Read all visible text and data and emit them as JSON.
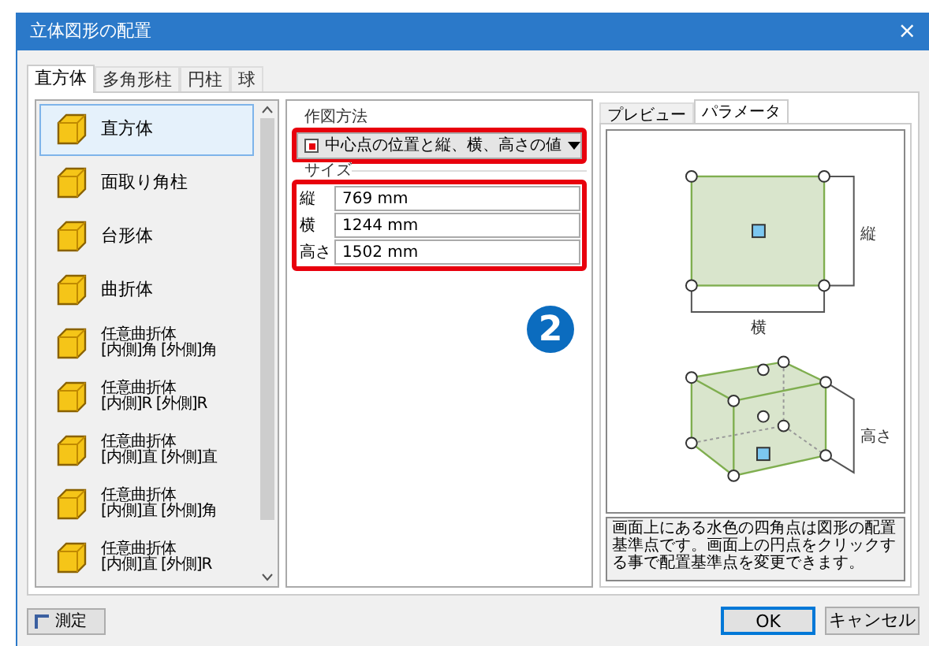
{
  "window": {
    "title": "立体図形の配置",
    "close": "×"
  },
  "shape_tabs": [
    {
      "label": "直方体",
      "selected": true
    },
    {
      "label": "多角形柱",
      "selected": false
    },
    {
      "label": "円柱",
      "selected": false
    },
    {
      "label": "球",
      "selected": false
    }
  ],
  "shape_list": [
    {
      "lines": [
        "直方体"
      ],
      "selected": true
    },
    {
      "lines": [
        "面取り角柱"
      ],
      "selected": false
    },
    {
      "lines": [
        "台形体"
      ],
      "selected": false
    },
    {
      "lines": [
        "曲折体"
      ],
      "selected": false
    },
    {
      "lines": [
        "任意曲折体",
        "[内側]角 [外側]角"
      ],
      "selected": false
    },
    {
      "lines": [
        "任意曲折体",
        "[内側]R [外側]R"
      ],
      "selected": false
    },
    {
      "lines": [
        "任意曲折体",
        "[内側]直 [外側]直"
      ],
      "selected": false
    },
    {
      "lines": [
        "任意曲折体",
        "[内側]直 [外側]角"
      ],
      "selected": false
    },
    {
      "lines": [
        "任意曲折体",
        "[内側]直 [外側]R"
      ],
      "selected": false
    }
  ],
  "method": {
    "label": "作図方法",
    "value": "中心点の位置と縦、横、高さの値"
  },
  "size": {
    "label": "サイズ",
    "fields": [
      {
        "label": "縦",
        "value": "769 mm"
      },
      {
        "label": "横",
        "value": "1244 mm"
      },
      {
        "label": "高さ",
        "value": "1502 mm"
      }
    ]
  },
  "callout": "2",
  "preview_tabs": [
    {
      "label": "プレビュー",
      "selected": false
    },
    {
      "label": "パラメータ",
      "selected": true
    }
  ],
  "diagram_labels": {
    "height": "縦",
    "width": "横",
    "depth": "高さ"
  },
  "description": "画面上にある水色の四角点は図形の配置基準点です。画面上の円点をクリックする事で配置基準点を変更できます。",
  "buttons": {
    "measure": "測定",
    "ok": "OK",
    "cancel": "キャンセル"
  }
}
